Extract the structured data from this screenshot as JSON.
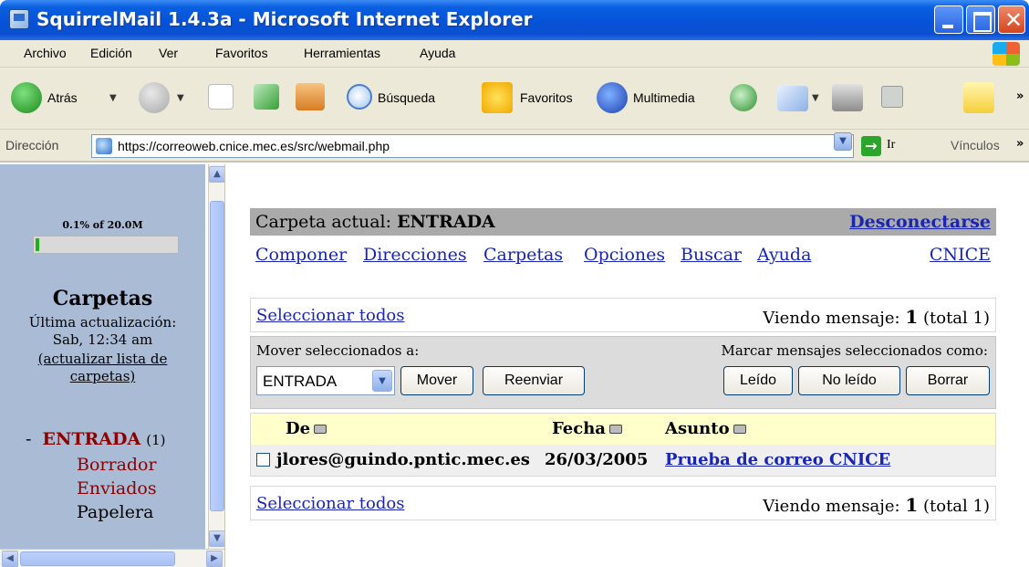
{
  "window": {
    "title": "SquirrelMail 1.4.3a - Microsoft Internet Explorer"
  },
  "menu": [
    "Archivo",
    "Edición",
    "Ver",
    "Favoritos",
    "Herramientas",
    "Ayuda"
  ],
  "toolbar": {
    "back": "Atrás",
    "search": "Búsqueda",
    "favorites": "Favoritos",
    "media": "Multimedia"
  },
  "address": {
    "label": "Dirección",
    "url": "https://correoweb.cnice.mec.es/src/webmail.php",
    "go": "Ir",
    "links": "Vínculos"
  },
  "sidebar": {
    "quota": "0.1% of 20.0M",
    "quota_fraction": 0.001,
    "heading": "Carpetas",
    "last_update_label": "Última actualización:",
    "last_update_time": "Sab, 12:34 am",
    "refresh_line1": "(actualizar lista de",
    "refresh_line2": "carpetas)",
    "folders": [
      {
        "prefix": "-",
        "name": "ENTRADA",
        "count": "(1)"
      },
      {
        "name": "Borrador"
      },
      {
        "name": "Enviados"
      },
      {
        "name": "Papelera"
      }
    ]
  },
  "header": {
    "current_label": "Carpeta actual:",
    "current_folder": "ENTRADA",
    "logout": "Desconectarse"
  },
  "nav": [
    "Componer",
    "Direcciones",
    "Carpetas",
    "Opciones",
    "Buscar",
    "Ayuda"
  ],
  "nav_right": "CNICE",
  "list_top": {
    "select_all": "Seleccionar todos",
    "viewing_label": "Viendo mensaje:",
    "viewing_num": "1",
    "viewing_total": "(total 1)"
  },
  "actions": {
    "move_label": "Mover seleccionados a:",
    "mark_label": "Marcar mensajes seleccionados como:",
    "folder_select": "ENTRADA",
    "move": "Mover",
    "forward": "Reenviar",
    "read": "Leído",
    "unread": "No leído",
    "delete": "Borrar"
  },
  "columns": {
    "from": "De",
    "date": "Fecha",
    "subject": "Asunto"
  },
  "messages": [
    {
      "from": "jlores@guindo.pntic.mec.es",
      "date": "26/03/2005",
      "subject": "Prueba de correo CNICE"
    }
  ],
  "colors": {
    "link": "#1a26b0",
    "sidebar_bg": "#aabbd6",
    "current_folder": "#8b0000",
    "folder": "#8b0000"
  }
}
